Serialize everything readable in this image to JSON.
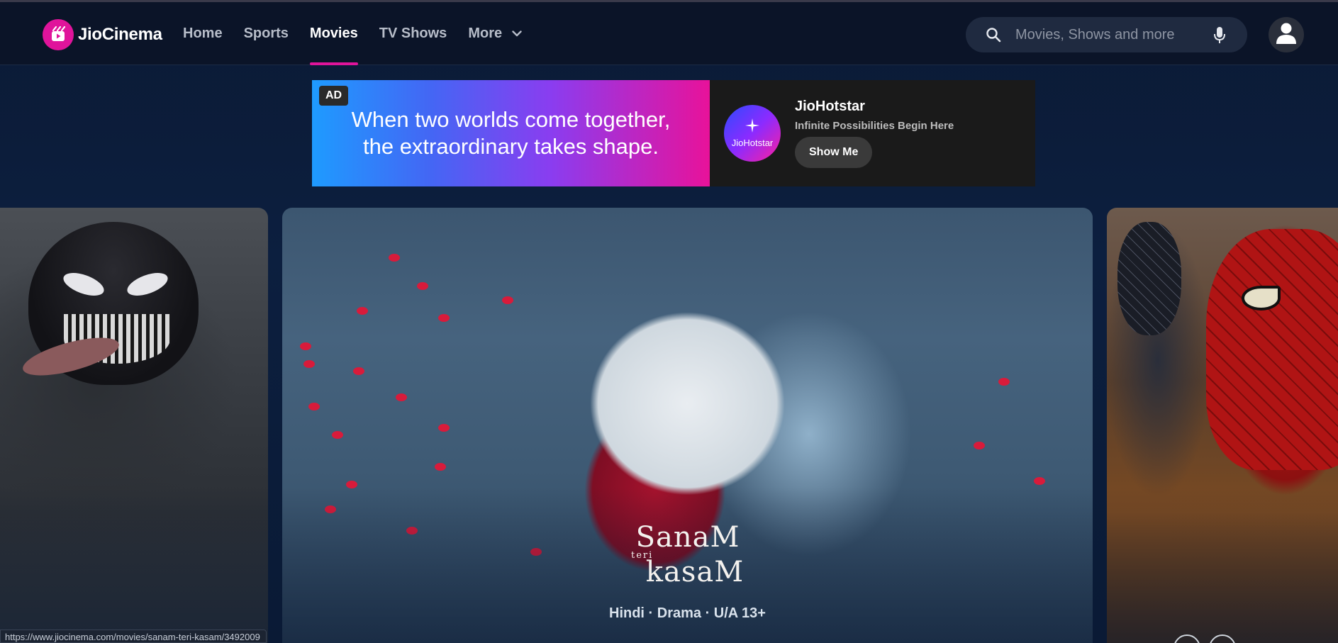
{
  "app": {
    "name": "JioCinema"
  },
  "nav": {
    "items": [
      {
        "label": "Home",
        "active": false
      },
      {
        "label": "Sports",
        "active": false
      },
      {
        "label": "Movies",
        "active": true
      },
      {
        "label": "TV Shows",
        "active": false
      }
    ],
    "more_label": "More"
  },
  "search": {
    "placeholder": "Movies, Shows and more",
    "value": ""
  },
  "ad": {
    "badge": "AD",
    "headline": "When two worlds come together, the extraordinary takes shape.",
    "brand": "JioHotstar",
    "logo_text": "JioHotstar",
    "tagline": "Infinite Possibilities Begin Here",
    "cta": "Show Me"
  },
  "hero": {
    "title_line1": "SanaM",
    "title_line2": "teri",
    "title_line3": "kasaM",
    "meta": "Hindi · Drama · U/A 13+"
  },
  "status_bar": {
    "url": "https://www.jiocinema.com/movies/sanam-teri-kasam/3492009"
  },
  "colors": {
    "accent": "#e0149b",
    "header_bg": "#0b1428",
    "page_bg": "#0b1a35"
  },
  "icons": [
    "jiocinema-logo-icon",
    "chevron-down-icon",
    "search-icon",
    "mic-icon",
    "user-icon",
    "jiohotstar-star-icon"
  ]
}
